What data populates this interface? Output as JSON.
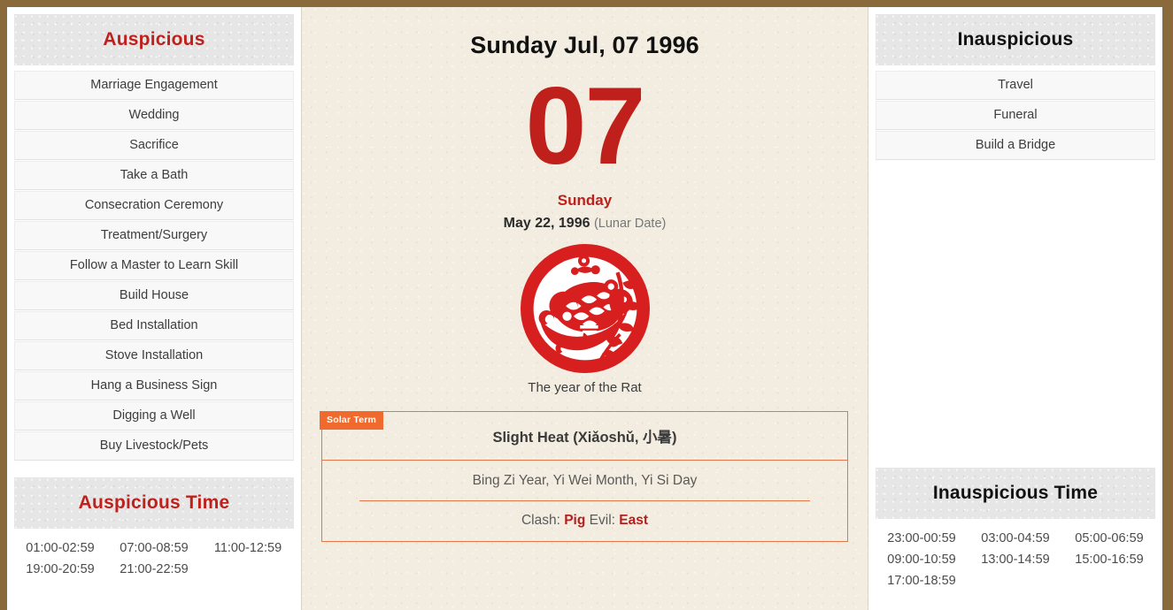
{
  "colors": {
    "frame_brown": "#8a6a3b",
    "accent_red": "#c0201c",
    "accent_orange": "#f06a2e",
    "paper_cream": "#f2ede0",
    "header_gray": "#e6e6e6"
  },
  "left": {
    "auspicious": {
      "header": "Auspicious",
      "items": [
        "Marriage Engagement",
        "Wedding",
        "Sacrifice",
        "Take a Bath",
        "Consecration Ceremony",
        "Treatment/Surgery",
        "Follow a Master to Learn Skill",
        "Build House",
        "Bed Installation",
        "Stove Installation",
        "Hang a Business Sign",
        "Digging a Well",
        "Buy Livestock/Pets"
      ]
    },
    "auspicious_time": {
      "header": "Auspicious Time",
      "times": [
        "01:00-02:59",
        "07:00-08:59",
        "11:00-12:59",
        "19:00-20:59",
        "21:00-22:59"
      ]
    }
  },
  "center": {
    "date_title": "Sunday Jul, 07 1996",
    "day_number": "07",
    "weekday": "Sunday",
    "lunar_date": "May 22, 1996",
    "lunar_note": "(Lunar Date)",
    "zodiac_icon": "zodiac-rat-papercut-icon",
    "zodiac_caption": "The year of the Rat",
    "solar_term": {
      "badge": "Solar Term",
      "name": "Slight Heat (Xiǎoshǔ, 小暑)",
      "ganzhi": "Bing Zi Year, Yi Wei Month, Yi Si Day",
      "clash_label": "Clash:",
      "clash_value": "Pig",
      "evil_label": "Evil:",
      "evil_value": "East"
    }
  },
  "right": {
    "inauspicious": {
      "header": "Inauspicious",
      "items": [
        "Travel",
        "Funeral",
        "Build a Bridge"
      ]
    },
    "inauspicious_time": {
      "header": "Inauspicious Time",
      "times": [
        "23:00-00:59",
        "03:00-04:59",
        "05:00-06:59",
        "09:00-10:59",
        "13:00-14:59",
        "15:00-16:59",
        "17:00-18:59"
      ]
    }
  }
}
